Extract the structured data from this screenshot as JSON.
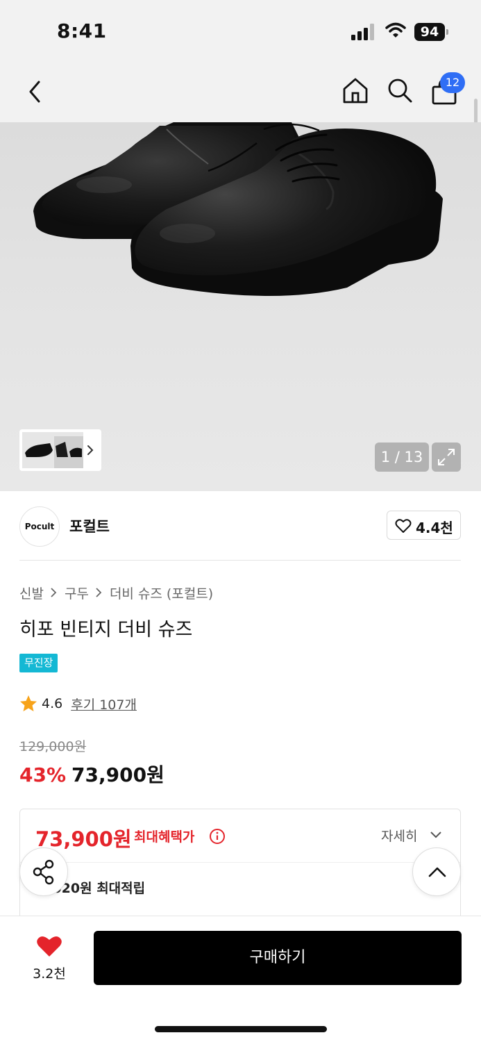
{
  "status_bar": {
    "time": "8:41",
    "battery": "94"
  },
  "nav": {
    "cart_count": "12"
  },
  "gallery": {
    "counter": "1 / 13"
  },
  "brand": {
    "logo_text": "Pocult",
    "name": "포컬트",
    "like_count": "4.4천"
  },
  "breadcrumb": [
    "신발",
    "구두",
    "더비 슈즈 (포컬트)"
  ],
  "product": {
    "title": "히포 빈티지 더비 슈즈",
    "tag": "무진장",
    "rating": "4.6",
    "reviews": "후기 107개",
    "original_price": "129,000원",
    "discount": "43%",
    "sale_price": "73,900원"
  },
  "benefit": {
    "price": "73,900원",
    "label": "최대혜택가",
    "detail_label": "자세히",
    "points": "1,020원 최대적립"
  },
  "bottom_bar": {
    "wish_count": "3.2천",
    "buy_label": "구매하기"
  },
  "colors": {
    "accent_red": "#e4242b",
    "tag_cyan": "#14b8d4",
    "badge_blue": "#2f6ef5"
  },
  "icons": [
    "back-icon",
    "home-icon",
    "search-icon",
    "cart-icon",
    "expand-icon",
    "heart-icon",
    "star-icon",
    "info-icon",
    "chevron-down-icon",
    "share-icon",
    "arrow-up-icon"
  ]
}
